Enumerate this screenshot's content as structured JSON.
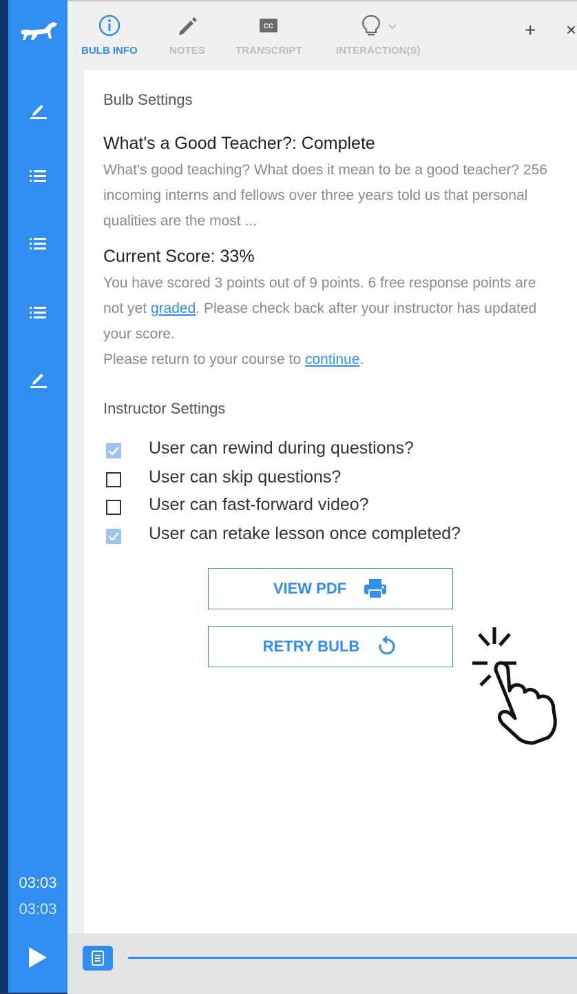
{
  "toolbar": {
    "tabs": [
      {
        "label": "BULB INFO",
        "icon": "info-circle-icon",
        "active": true
      },
      {
        "label": "NOTES",
        "icon": "pencil-icon",
        "active": false
      },
      {
        "label": "TRANSCRIPT",
        "icon": "closed-caption-icon",
        "active": false
      },
      {
        "label": "INTERACTION(S)",
        "icon": "lightbulb-icon",
        "active": false
      }
    ],
    "add_label": "+",
    "close_label": "×"
  },
  "sidebar": {
    "logo": "dachshund-logo",
    "items": [
      "edit-icon",
      "list-icon",
      "list-icon",
      "list-icon",
      "edit-icon"
    ],
    "current_time": "03:03",
    "total_time": "03:03"
  },
  "bulb": {
    "section_title": "Bulb Settings",
    "title": "What's a Good Teacher?: Complete",
    "description": "What's good teaching? What does it mean to be a good teacher? 256 incoming interns and fellows over three years told us that personal qualities are the most ...",
    "score_title": "Current Score: 33%",
    "score_text_1": "You have scored 3 points out of 9 points. 6 free response points are not yet ",
    "graded_link": "graded",
    "score_text_2": ". Please check back after your instructor has updated your score.",
    "return_text": "Please return to your course to ",
    "continue_link": "continue",
    "return_end": "."
  },
  "instructor": {
    "section_title": "Instructor Settings",
    "settings": [
      {
        "label": "User can rewind during questions?",
        "checked": true
      },
      {
        "label": "User can skip questions?",
        "checked": false
      },
      {
        "label": "User can fast-forward video?",
        "checked": false
      },
      {
        "label": "User can retake lesson once completed?",
        "checked": true
      }
    ]
  },
  "actions": {
    "view_pdf": "VIEW PDF",
    "retry_bulb": "RETRY BULB"
  },
  "colors": {
    "accent": "#2f8ef0",
    "sidebar": "#2f8ef0",
    "checkbox_checked": "#9ec3f2"
  }
}
